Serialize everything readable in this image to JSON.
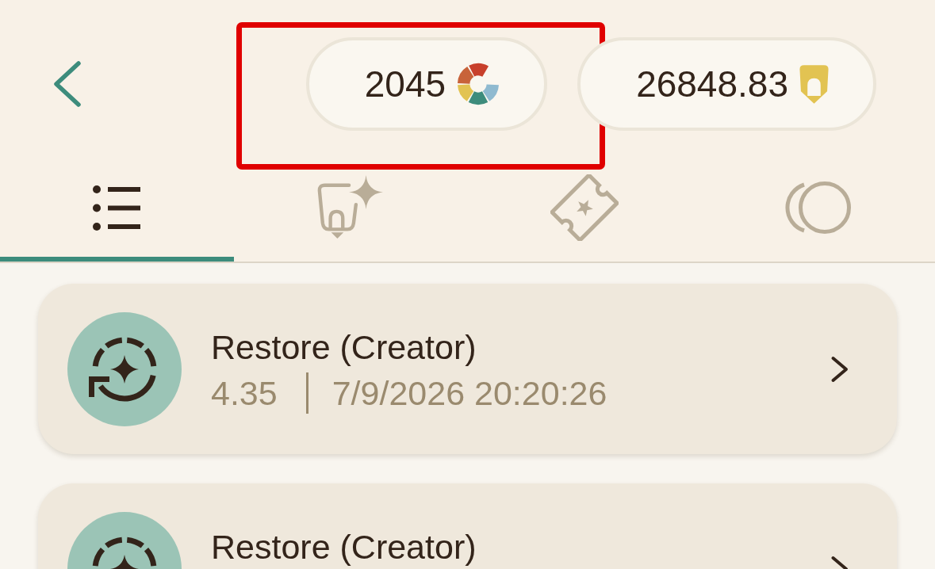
{
  "balances": [
    {
      "kind": "colors",
      "amount": "2045",
      "highlighted": true
    },
    {
      "kind": "pencil",
      "amount": "26848.83",
      "highlighted": false
    }
  ],
  "tabs": [
    {
      "kind": "list",
      "selected": true
    },
    {
      "kind": "pencil-sparkle",
      "selected": false
    },
    {
      "kind": "ticket",
      "selected": false
    },
    {
      "kind": "circles",
      "selected": false
    }
  ],
  "records": [
    {
      "kind": "restore",
      "title": "Restore (Creator)",
      "amount": "4.35",
      "time": "7/9/2026 20:20:26"
    },
    {
      "kind": "restore",
      "title": "Restore (Creator)"
    }
  ]
}
